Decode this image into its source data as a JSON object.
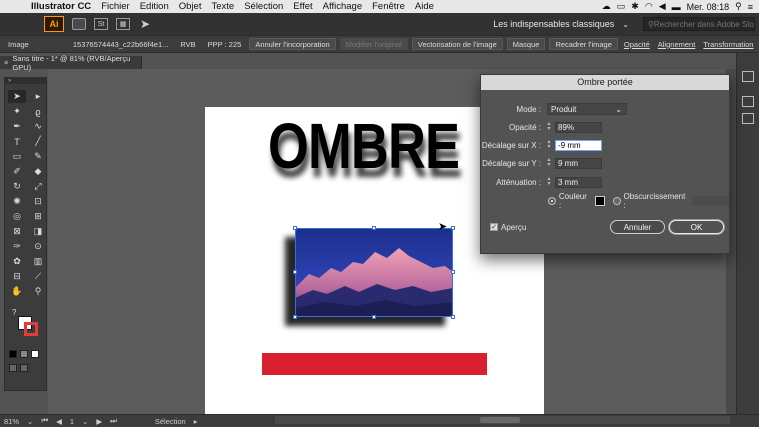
{
  "menubar": {
    "app_name": "Illustrator CC",
    "items": [
      "Fichier",
      "Edition",
      "Objet",
      "Texte",
      "Sélection",
      "Effet",
      "Affichage",
      "Fenêtre",
      "Aide"
    ],
    "clock": "Mer. 08:18"
  },
  "appbar": {
    "logo": "Ai",
    "st_label": "St",
    "workspace": "Les indispensables classiques",
    "stock_search_placeholder": "Rechercher dans Adobe Stock"
  },
  "controlbar": {
    "object_type": "Image",
    "filename": "15376574443_c22b66f4e1...",
    "color_mode": "RVB",
    "ppp": "PPP : 225",
    "annuler_incorporation": "Annuler l'incorporation",
    "modifier_original": "Modifier l'original",
    "vectorisation": "Vectorisation de l'image",
    "masque": "Masque",
    "recadrer": "Recadrer l'image",
    "opacite": "Opacité",
    "alignement": "Alignement",
    "transformation": "Transformation"
  },
  "doc_tab": {
    "title": "Sans titre - 1* @ 81% (RVB/Aperçu GPU)"
  },
  "artwork": {
    "headline": "OMBRE"
  },
  "dialog": {
    "title": "Ombre portée",
    "mode_label": "Mode :",
    "mode_value": "Produit",
    "opacity_label": "Opacité :",
    "opacity_value": "89%",
    "offset_x_label": "Décalage sur X :",
    "offset_x_value": "-9 mm",
    "offset_y_label": "Décalage sur Y :",
    "offset_y_value": "9 mm",
    "blur_label": "Atténuation :",
    "blur_value": "3 mm",
    "color_label": "Couleur :",
    "darkness_label": "Obscurcissement :",
    "preview_label": "Aperçu",
    "cancel_label": "Annuler",
    "ok_label": "OK",
    "shadow_color": "#000000"
  },
  "statusbar": {
    "zoom": "81%",
    "page": "1",
    "tool_status": "Sélection"
  }
}
